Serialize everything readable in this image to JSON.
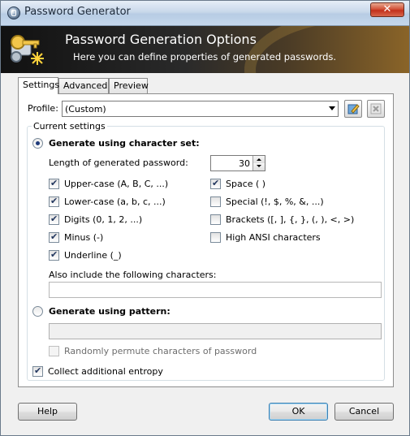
{
  "window": {
    "title": "Password Generator",
    "close_label": "✕"
  },
  "banner": {
    "title": "Password Generation Options",
    "subtitle": "Here you can define properties of generated passwords."
  },
  "tabs": [
    {
      "label": "Settings",
      "active": true
    },
    {
      "label": "Advanced",
      "active": false
    },
    {
      "label": "Preview",
      "active": false
    }
  ],
  "profile": {
    "label": "Profile:",
    "value": "(Custom)"
  },
  "group": {
    "title": "Current settings"
  },
  "charset": {
    "radio_label": "Generate using character set:",
    "selected": true,
    "length_label": "Length of generated password:",
    "length_value": "30",
    "left_options": [
      {
        "label": "Upper-case (A, B, C, ...)",
        "checked": true
      },
      {
        "label": "Lower-case (a, b, c, ...)",
        "checked": true
      },
      {
        "label": "Digits (0, 1, 2, ...)",
        "checked": true
      },
      {
        "label": "Minus (-)",
        "checked": true
      },
      {
        "label": "Underline (_)",
        "checked": true
      }
    ],
    "right_options": [
      {
        "label": "Space ( )",
        "checked": true
      },
      {
        "label": "Special (!, $, %, &, ...)",
        "checked": false
      },
      {
        "label": "Brackets ([, ], {, }, (, ), <, >)",
        "checked": false
      },
      {
        "label": "High ANSI characters",
        "checked": false
      }
    ],
    "also_include_label": "Also include the following characters:",
    "also_include_value": ""
  },
  "pattern": {
    "radio_label": "Generate using pattern:",
    "selected": false,
    "value": "",
    "permute_label": "Randomly permute characters of password",
    "permute_checked": false
  },
  "entropy": {
    "label": "Collect additional entropy",
    "checked": true
  },
  "buttons": {
    "help": "Help",
    "ok": "OK",
    "cancel": "Cancel"
  }
}
